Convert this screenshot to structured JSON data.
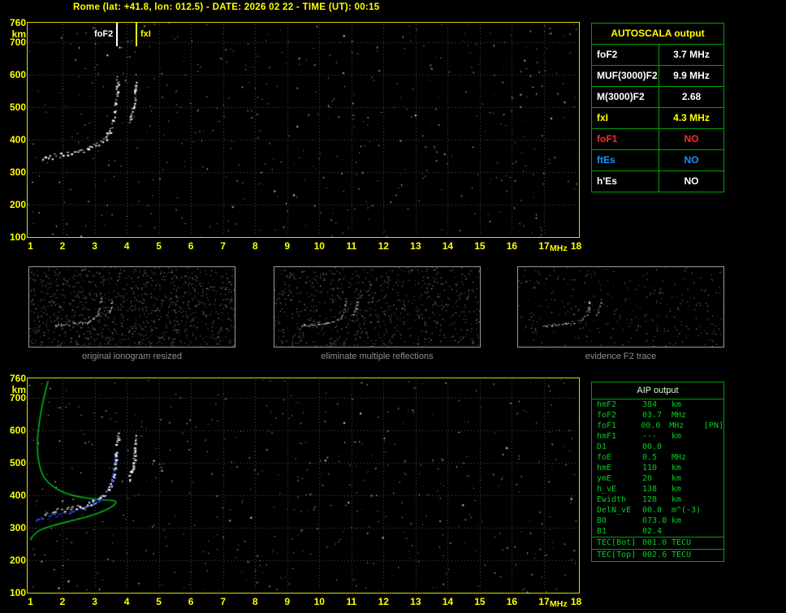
{
  "title": "Rome (lat: +41.8, lon: 012.5) - DATE: 2026 02 22 - TIME (UT): 00:15",
  "colors": {
    "accent_yellow": "#ffff00",
    "plot_border": "#d8d800",
    "table_border": "#00a000",
    "grid_gray": "#585858",
    "trace_white": "#ffffff",
    "trace_blue": "#2e4fff",
    "profile_green": "#00b41e",
    "negative_red": "#ff2a2a",
    "info_blue": "#1e90ff",
    "caption_gray": "#8f8f8f"
  },
  "autoscala_table": {
    "title": "AUTOSCALA output",
    "rows": [
      {
        "name": "foF2",
        "value": "3.7 MHz",
        "color": "#ffffff"
      },
      {
        "name": "MUF(3000)F2",
        "value": "9.9 MHz",
        "color": "#ffffff"
      },
      {
        "name": "M(3000)F2",
        "value": "2.68",
        "color": "#ffffff"
      },
      {
        "name": "fxI",
        "value": "4.3 MHz",
        "color": "#ffff00"
      },
      {
        "name": "foF1",
        "value": "NO",
        "color": "#ff2a2a"
      },
      {
        "name": "ftEs",
        "value": "NO",
        "color": "#1e90ff"
      },
      {
        "name": "h'Es",
        "value": "NO",
        "color": "#ffffff"
      }
    ]
  },
  "aip_table": {
    "title": "AIP output",
    "rows": [
      {
        "name": "hmF2",
        "value": "384",
        "unit": "km",
        "extra": ""
      },
      {
        "name": "foF2",
        "value": "03.7",
        "unit": "MHz",
        "extra": ""
      },
      {
        "name": "foF1",
        "value": "00.0",
        "unit": "MHz",
        "extra": "[PN]"
      },
      {
        "name": "hmF1",
        "value": "---",
        "unit": "km",
        "extra": ""
      },
      {
        "name": "D1",
        "value": "00.0",
        "unit": "",
        "extra": ""
      },
      {
        "name": "foE",
        "value": "0.5",
        "unit": "MHz",
        "extra": ""
      },
      {
        "name": "hmE",
        "value": "110",
        "unit": "km",
        "extra": ""
      },
      {
        "name": "ymE",
        "value": "20",
        "unit": "km",
        "extra": ""
      },
      {
        "name": "h_vE",
        "value": "138",
        "unit": "km",
        "extra": ""
      },
      {
        "name": "Ewidth",
        "value": "128",
        "unit": "km",
        "extra": ""
      },
      {
        "name": "DelN_vE",
        "value": "00.0",
        "unit": "m^(-3)",
        "extra": ""
      },
      {
        "name": "B0",
        "value": "073.0",
        "unit": "km",
        "extra": ""
      },
      {
        "name": "B1",
        "value": "02.4",
        "unit": "",
        "extra": ""
      }
    ],
    "tec_rows": [
      {
        "name": "TEC[Bot]",
        "value": "001.0",
        "unit": "TECU",
        "extra": ""
      },
      {
        "name": "TEC[Top]",
        "value": "002.6",
        "unit": "TECU",
        "extra": ""
      }
    ]
  },
  "thumbnails": [
    {
      "caption": "original ionogram resized"
    },
    {
      "caption": "eliminate multiple reflections"
    },
    {
      "caption": "evidence F2 trace"
    }
  ],
  "chart_data": {
    "type": "scatter",
    "title": "Ionogram with autoscaled F2 trace and restored electron density profile",
    "xlabel": "MHz",
    "ylabel": "km",
    "xlim": [
      1,
      18
    ],
    "ylim": [
      100,
      760
    ],
    "x_ticks": [
      1,
      2,
      3,
      4,
      5,
      6,
      7,
      8,
      9,
      10,
      11,
      12,
      13,
      14,
      15,
      16,
      17,
      18
    ],
    "y_ticks": [
      760,
      700,
      600,
      500,
      400,
      300,
      200,
      100
    ],
    "grid": "dotted",
    "markers": [
      {
        "label": "foF2",
        "freq": 3.7,
        "color": "#ffffff"
      },
      {
        "label": "fxI",
        "freq": 4.3,
        "color": "#ffff00"
      }
    ],
    "traces": {
      "f2_ordinary": [
        [
          1.35,
          345
        ],
        [
          1.7,
          350
        ],
        [
          2.1,
          357
        ],
        [
          2.5,
          365
        ],
        [
          2.85,
          375
        ],
        [
          3.1,
          388
        ],
        [
          3.3,
          403
        ],
        [
          3.45,
          425
        ],
        [
          3.55,
          455
        ],
        [
          3.62,
          492
        ],
        [
          3.66,
          530
        ],
        [
          3.69,
          565
        ],
        [
          3.7,
          600
        ]
      ],
      "f2_extraordinary": [
        [
          4.05,
          445
        ],
        [
          4.12,
          470
        ],
        [
          4.18,
          500
        ],
        [
          4.23,
          530
        ],
        [
          4.27,
          560
        ],
        [
          4.3,
          590
        ]
      ],
      "restored_blue": [
        [
          1.15,
          322
        ],
        [
          1.5,
          332
        ],
        [
          1.9,
          342
        ],
        [
          2.3,
          352
        ],
        [
          2.7,
          364
        ],
        [
          3.0,
          378
        ],
        [
          3.2,
          394
        ],
        [
          3.38,
          415
        ],
        [
          3.5,
          442
        ],
        [
          3.58,
          472
        ],
        [
          3.63,
          505
        ],
        [
          3.67,
          540
        ]
      ],
      "profile_green": [
        [
          1.55,
          752
        ],
        [
          1.4,
          695
        ],
        [
          1.27,
          625
        ],
        [
          1.2,
          560
        ],
        [
          1.25,
          500
        ],
        [
          1.4,
          455
        ],
        [
          1.7,
          425
        ],
        [
          2.1,
          405
        ],
        [
          2.6,
          393
        ],
        [
          3.1,
          387
        ],
        [
          3.5,
          384
        ],
        [
          3.7,
          382
        ],
        [
          3.6,
          368
        ],
        [
          3.3,
          352
        ],
        [
          2.85,
          336
        ],
        [
          2.3,
          322
        ],
        [
          1.8,
          310
        ],
        [
          1.35,
          296
        ],
        [
          1.1,
          280
        ],
        [
          1.0,
          262
        ]
      ]
    }
  }
}
